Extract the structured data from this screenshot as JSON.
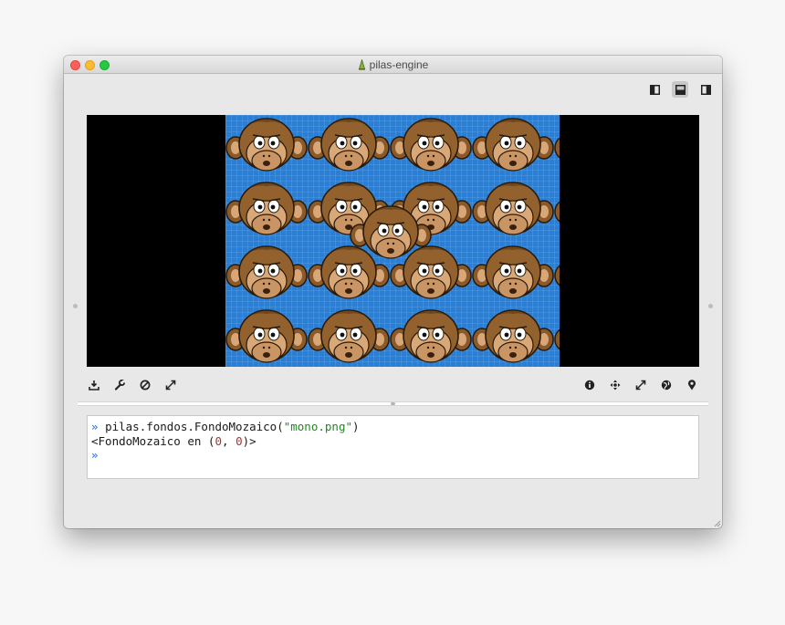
{
  "window": {
    "title": "pilas-engine"
  },
  "layout_buttons": [
    {
      "icon": "panel-left-icon",
      "active": false
    },
    {
      "icon": "panel-bottom-icon",
      "active": true
    },
    {
      "icon": "panel-right-icon",
      "active": false
    }
  ],
  "canvas": {
    "background_color": "#2a7ed4",
    "stage_color": "#000000",
    "tiles": {
      "rows": 4,
      "columns": 4
    },
    "extra_actor": "monkey"
  },
  "toolbar_left": [
    "save-icon",
    "wrench-icon",
    "block-icon",
    "expand-icon"
  ],
  "toolbar_right": [
    "info-icon",
    "move-icon",
    "expand-icon",
    "globe-icon",
    "pin-icon"
  ],
  "console": {
    "prompt": "»",
    "lines": [
      {
        "cmd_prefix": "pilas.fondos.FondoMozaico(",
        "cmd_string": "\"mono.png\"",
        "cmd_suffix": ")"
      },
      {
        "out_prefix": "<FondoMozaico en (",
        "out_x": "0",
        "out_sep": ", ",
        "out_y": "0",
        "out_suffix": ")>"
      }
    ]
  },
  "colors": {
    "accent_prompt": "#3c7ff0",
    "string": "#1f8a1f",
    "number": "#b03030"
  }
}
